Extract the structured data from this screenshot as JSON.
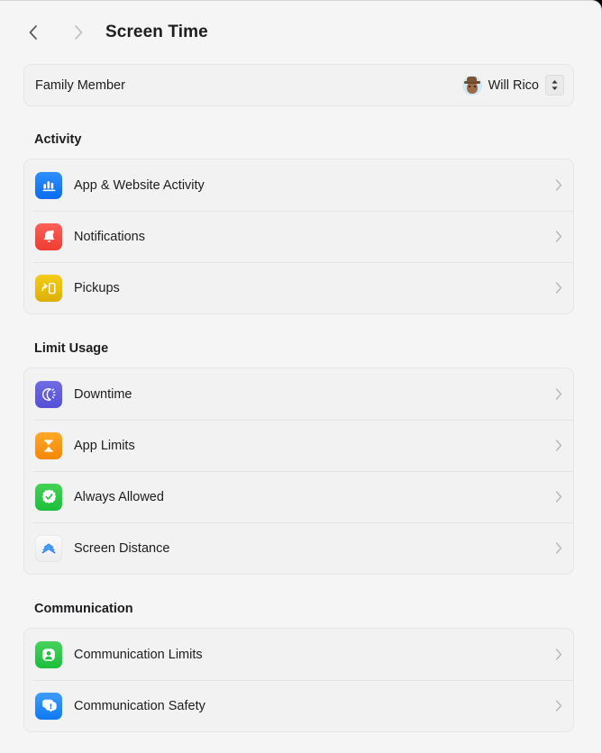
{
  "window": {
    "title": "Screen Time"
  },
  "toolbar": {
    "back_icon": "chevron-left-icon",
    "forward_icon": "chevron-right-icon",
    "title": "Screen Time"
  },
  "family_member": {
    "label": "Family Member",
    "selected": "Will Rico",
    "avatar_icon": "memoji-avatar",
    "stepper_icon": "up-down-chevron-icon"
  },
  "sections": [
    {
      "title": "Activity",
      "rows": [
        {
          "label": "App & Website Activity",
          "icon": "bar-chart-icon",
          "icon_class": "ic-bars",
          "glyph": "bars"
        },
        {
          "label": "Notifications",
          "icon": "bell-icon",
          "icon_class": "ic-bell",
          "glyph": "bell"
        },
        {
          "label": "Pickups",
          "icon": "pickups-icon",
          "icon_class": "ic-pickup",
          "glyph": "pickup"
        }
      ]
    },
    {
      "title": "Limit Usage",
      "rows": [
        {
          "label": "Downtime",
          "icon": "downtime-icon",
          "icon_class": "ic-downtime",
          "glyph": "downtime"
        },
        {
          "label": "App Limits",
          "icon": "hourglass-icon",
          "icon_class": "ic-applimits",
          "glyph": "hourglass"
        },
        {
          "label": "Always Allowed",
          "icon": "checkmark-badge-icon",
          "icon_class": "ic-allowed",
          "glyph": "check"
        },
        {
          "label": "Screen Distance",
          "icon": "screen-distance-icon",
          "icon_class": "ic-distance",
          "glyph": "distance"
        }
      ]
    },
    {
      "title": "Communication",
      "rows": [
        {
          "label": "Communication Limits",
          "icon": "person-circle-icon",
          "icon_class": "ic-commlimits",
          "glyph": "person"
        },
        {
          "label": "Communication Safety",
          "icon": "message-warning-icon",
          "icon_class": "ic-commsafety",
          "glyph": "message"
        }
      ]
    }
  ],
  "row_chevron_icon": "chevron-right-icon",
  "colors": {
    "background": "#f5f5f5",
    "card": "#f2f2f2",
    "separator": "#e4e4e4",
    "text": "#1d1d1f",
    "chevron": "#b9b9b9"
  }
}
